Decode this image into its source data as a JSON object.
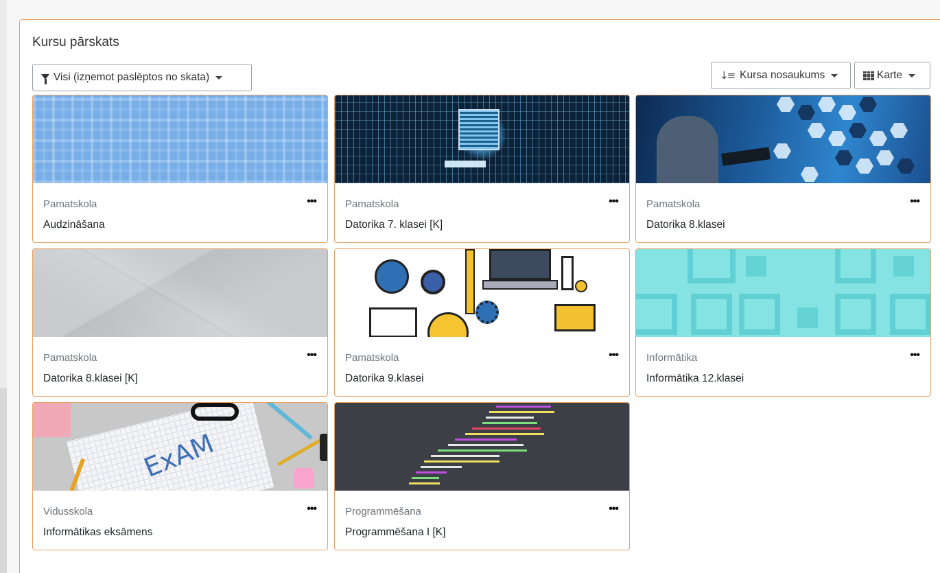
{
  "block": {
    "title": "Kursu pārskats",
    "filter_label": "Visi (izņemot paslēptos no skata)",
    "sort_label": "Kursa nosaukums",
    "view_label": "Karte"
  },
  "icons": {
    "filter": "filter-icon",
    "sort": "sort-alpha-icon",
    "view": "grid-icon",
    "card_menu": "more-dots-icon"
  },
  "colors": {
    "accent_border": "#e8a065",
    "category_text": "#6a737b"
  },
  "courses": [
    {
      "category": "Pamatskola",
      "name": "Audzināšana"
    },
    {
      "category": "Pamatskola",
      "name": "Datorika 7. klasei [K]"
    },
    {
      "category": "Pamatskola",
      "name": "Datorika 8.klasei"
    },
    {
      "category": "Pamatskola",
      "name": "Datorika 8.klasei [K]"
    },
    {
      "category": "Pamatskola",
      "name": "Datorika 9.klasei"
    },
    {
      "category": "Informātika",
      "name": "Informātika 12.klasei"
    },
    {
      "category": "Vidusskola",
      "name": "Informātikas eksāmens"
    },
    {
      "category": "Programmēšana",
      "name": "Programmēšana I [K]"
    }
  ],
  "card_menu_label": "•••"
}
